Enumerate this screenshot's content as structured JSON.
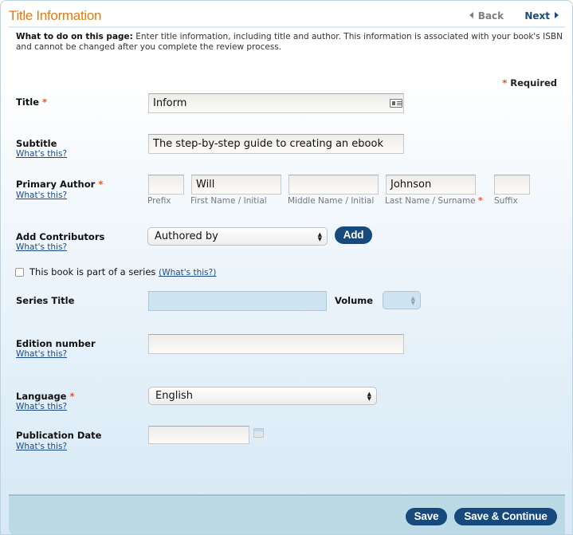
{
  "header": {
    "title": "Title Information",
    "back_label": "Back",
    "next_label": "Next"
  },
  "instructions": {
    "lead": "What to do on this page:",
    "text": " Enter title information, including title and author. This information is associated with your book's ISBN and cannot be changed after you complete the review process."
  },
  "required_note": {
    "star": "*",
    "label": "Required"
  },
  "help_link": "What's this?",
  "fields": {
    "title": {
      "label": "Title",
      "required": "*",
      "value": "Inform"
    },
    "subtitle": {
      "label": "Subtitle",
      "value": "The step-by-step guide to creating an ebook"
    },
    "primary_author": {
      "label": "Primary Author",
      "required": "*",
      "prefix": {
        "label": "Prefix",
        "value": ""
      },
      "first": {
        "label": "First Name / Initial",
        "value": "Will"
      },
      "middle": {
        "label": "Middle Name / Initial",
        "value": ""
      },
      "last": {
        "label": "Last Name / Surname",
        "required": "*",
        "value": "Johnson"
      },
      "suffix": {
        "label": "Suffix",
        "value": ""
      }
    },
    "contributors": {
      "label": "Add Contributors",
      "selected": "Authored by",
      "add_label": "Add"
    },
    "series_checkbox": {
      "label": "This book is part of a series",
      "help": "(What's this?)",
      "checked": false
    },
    "series_title": {
      "label": "Series Title",
      "value": ""
    },
    "volume": {
      "label": "Volume",
      "selected": ""
    },
    "edition": {
      "label": "Edition number",
      "value": ""
    },
    "language": {
      "label": "Language",
      "required": "*",
      "selected": "English"
    },
    "publication_date": {
      "label": "Publication Date",
      "value": ""
    }
  },
  "footer": {
    "save_label": "Save",
    "save_continue_label": "Save & Continue"
  }
}
